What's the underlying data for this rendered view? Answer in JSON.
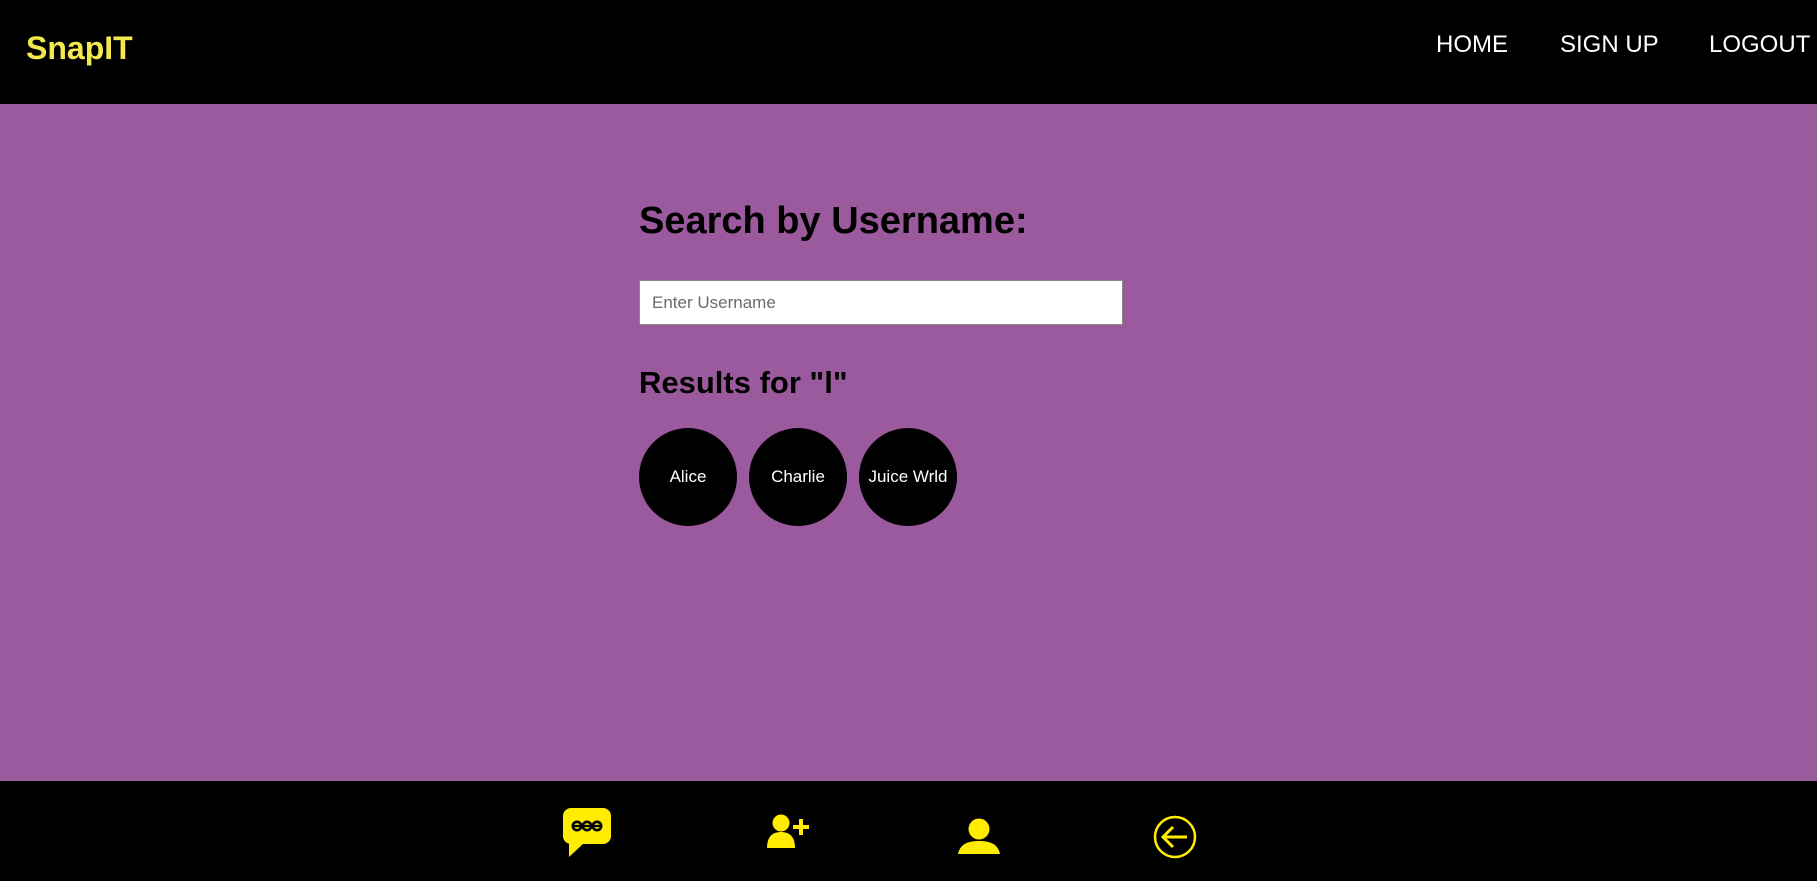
{
  "header": {
    "brand": "SnapIT",
    "nav": {
      "home": "HOME",
      "signup": "SIGN UP",
      "logout": "LOGOUT"
    }
  },
  "search": {
    "heading": "Search by Username:",
    "placeholder": "Enter Username",
    "value": ""
  },
  "results": {
    "heading": "Results for \"l\"",
    "users": [
      "Alice",
      "Charlie",
      "Juice Wrld"
    ]
  },
  "bottom_nav": {
    "items": [
      {
        "icon": "chat-bubble-icon"
      },
      {
        "icon": "add-friend-icon"
      },
      {
        "icon": "profile-icon"
      },
      {
        "icon": "back-arrow-icon"
      }
    ]
  },
  "colors": {
    "background": "#9c5a9e",
    "bars": "#000000",
    "brand": "#f2e94e",
    "icon": "#ffec00"
  }
}
